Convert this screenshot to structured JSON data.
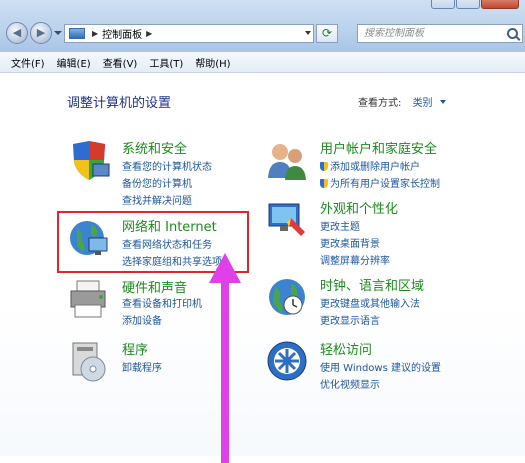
{
  "address": {
    "crumb": "控制面板"
  },
  "search": {
    "placeholder": "搜索控制面板"
  },
  "menu": [
    "文件(F)",
    "编辑(E)",
    "查看(V)",
    "工具(T)",
    "帮助(H)"
  ],
  "page_title": "调整计算机的设置",
  "view_by": {
    "label": "查看方式:",
    "value": "类别"
  },
  "categories": {
    "system_security": {
      "title": "系统和安全",
      "links": [
        "查看您的计算机状态",
        "备份您的计算机",
        "查找并解决问题"
      ]
    },
    "user_accounts": {
      "title": "用户帐户和家庭安全",
      "links": [
        "添加或删除用户帐户",
        "为所有用户设置家长控制"
      ]
    },
    "network": {
      "title": "网络和 Internet",
      "links": [
        "查看网络状态和任务",
        "选择家庭组和共享选项"
      ]
    },
    "appearance": {
      "title": "外观和个性化",
      "links": [
        "更改主题",
        "更改桌面背景",
        "调整屏幕分辨率"
      ]
    },
    "hardware": {
      "title": "硬件和声音",
      "links": [
        "查看设备和打印机",
        "添加设备"
      ]
    },
    "clock": {
      "title": "时钟、语言和区域",
      "links": [
        "更改键盘或其他输入法",
        "更改显示语言"
      ]
    },
    "programs": {
      "title": "程序",
      "links": [
        "卸载程序"
      ]
    },
    "ease": {
      "title": "轻松访问",
      "links": [
        "使用 Windows 建议的设置",
        "优化视频显示"
      ]
    }
  },
  "colors": {
    "heading_green": "#1d8a1d",
    "link_blue": "#1e57a0",
    "title_blue": "#1e3287",
    "highlight_red": "#e0262b",
    "arrow_magenta": "#e040e8"
  }
}
